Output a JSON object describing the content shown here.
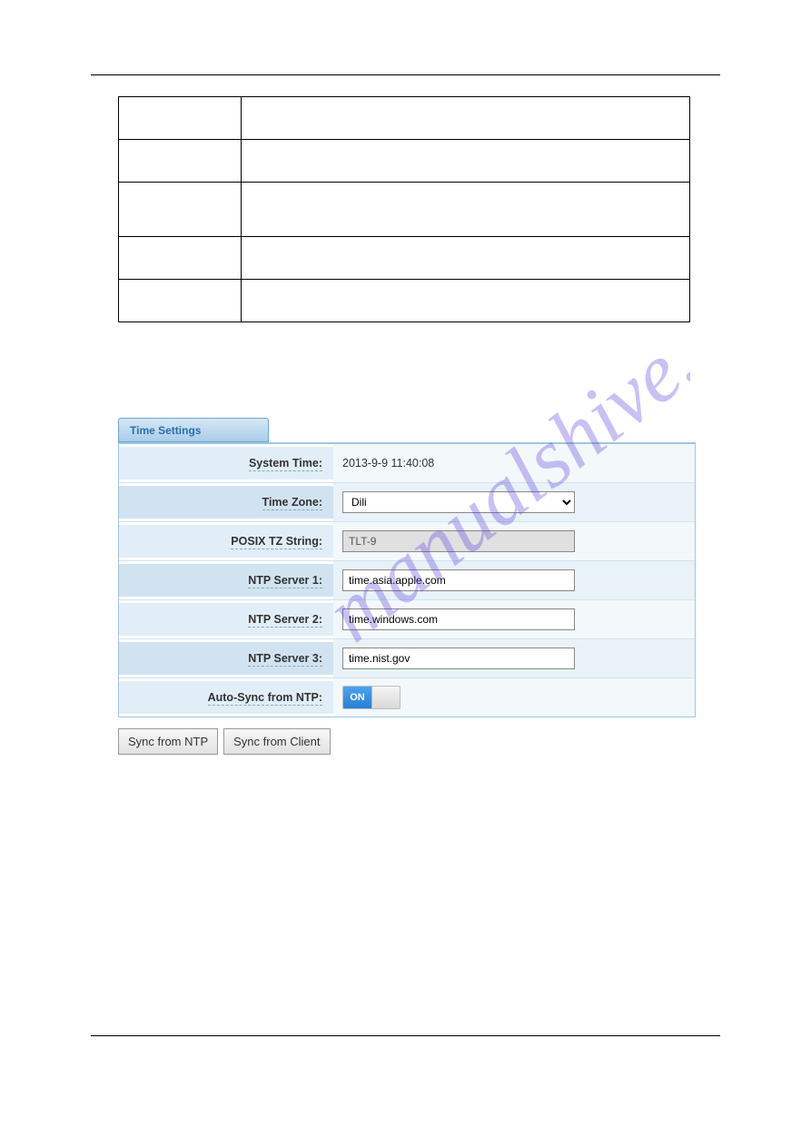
{
  "tabs": {
    "time_settings": "Time Settings"
  },
  "fields": {
    "system_time": {
      "label": "System Time:",
      "value": "2013-9-9 11:40:08"
    },
    "time_zone": {
      "label": "Time Zone:",
      "value": "Dili"
    },
    "posix_tz": {
      "label": "POSIX TZ String:",
      "value": "TLT-9"
    },
    "ntp1": {
      "label": "NTP Server 1:",
      "value": "time.asia.apple.com"
    },
    "ntp2": {
      "label": "NTP Server 2:",
      "value": "time.windows.com"
    },
    "ntp3": {
      "label": "NTP Server 3:",
      "value": "time.nist.gov"
    },
    "autosync": {
      "label": "Auto-Sync from NTP:",
      "state": "ON"
    }
  },
  "buttons": {
    "sync_ntp": "Sync from NTP",
    "sync_client": "Sync from Client"
  },
  "watermark": "manualshive.com"
}
